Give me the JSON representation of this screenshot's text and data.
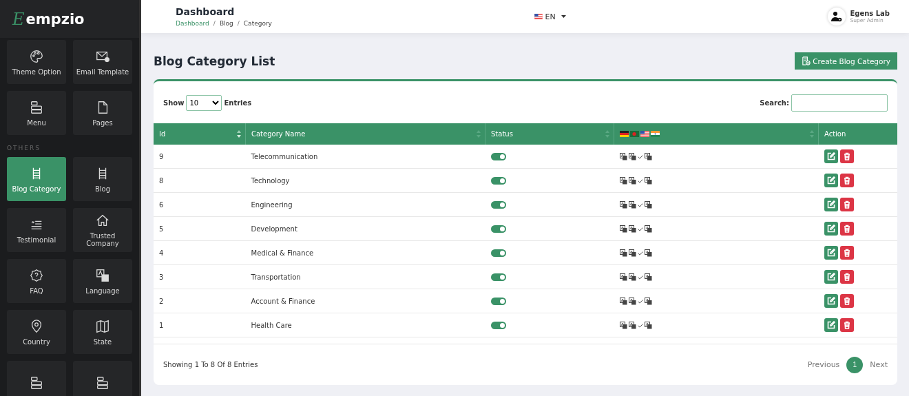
{
  "sidebar": {
    "brand": {
      "mark": "E",
      "name": "empzio"
    },
    "groups": [
      {
        "items": [
          {
            "label": "Theme Option",
            "selected": false
          },
          {
            "label": "Email Template",
            "selected": false
          },
          {
            "label": "Menu",
            "selected": false
          },
          {
            "label": "Pages",
            "selected": false
          }
        ]
      },
      {
        "heading": "OTHERS",
        "items": [
          {
            "label": "Blog Category",
            "selected": true
          },
          {
            "label": "Blog",
            "selected": false
          },
          {
            "label": "Testimonial",
            "selected": false
          },
          {
            "label": "Trusted Company",
            "selected": false
          },
          {
            "label": "FAQ",
            "selected": false
          },
          {
            "label": "Language",
            "selected": false
          },
          {
            "label": "Country",
            "selected": false
          },
          {
            "label": "State",
            "selected": false
          },
          {
            "selected": false
          },
          {
            "selected": false
          }
        ]
      }
    ]
  },
  "topbar": {
    "title": "Dashboard",
    "breadcrumbs": [
      "Dashboard",
      "Blog",
      "Category"
    ],
    "breadcrumb_separator": "/",
    "language": "EN",
    "user": {
      "name": "Egens Lab",
      "role": "Super Admin"
    }
  },
  "page": {
    "title": "Blog Category List",
    "create_button": "Create Blog Category"
  },
  "table": {
    "show_label": "Show",
    "page_size": "10",
    "entries_label": "Entries",
    "search_label": "Search:",
    "columns": [
      {
        "kind": "text",
        "label": "Id",
        "sortable": true
      },
      {
        "kind": "text",
        "label": "Category Name",
        "sortable": true
      },
      {
        "kind": "text",
        "label": "Status",
        "sortable": true
      },
      {
        "kind": "flags",
        "sortable": true
      },
      {
        "kind": "text",
        "label": "Action",
        "sortable": false
      }
    ],
    "rows": [
      {
        "id": "9",
        "name": "Telecommunication",
        "on": true,
        "languages": [
          {
            "kind": "translate"
          },
          {
            "kind": "translate"
          },
          {
            "kind": "current"
          },
          {
            "kind": "translate"
          }
        ]
      },
      {
        "id": "8",
        "name": "Technology",
        "on": true,
        "languages": [
          {
            "kind": "translate"
          },
          {
            "kind": "translate"
          },
          {
            "kind": "current"
          },
          {
            "kind": "translate"
          }
        ]
      },
      {
        "id": "6",
        "name": "Engineering",
        "on": true,
        "languages": [
          {
            "kind": "translate"
          },
          {
            "kind": "translate"
          },
          {
            "kind": "current"
          },
          {
            "kind": "translate"
          }
        ]
      },
      {
        "id": "5",
        "name": "Development",
        "on": true,
        "languages": [
          {
            "kind": "translate"
          },
          {
            "kind": "translate"
          },
          {
            "kind": "current"
          },
          {
            "kind": "translate"
          }
        ]
      },
      {
        "id": "4",
        "name": "Medical & Finance",
        "on": true,
        "languages": [
          {
            "kind": "translate"
          },
          {
            "kind": "translate"
          },
          {
            "kind": "current"
          },
          {
            "kind": "translate"
          }
        ]
      },
      {
        "id": "3",
        "name": "Transportation",
        "on": true,
        "languages": [
          {
            "kind": "translate"
          },
          {
            "kind": "translate"
          },
          {
            "kind": "current"
          },
          {
            "kind": "translate"
          }
        ]
      },
      {
        "id": "2",
        "name": "Account & Finance",
        "on": true,
        "languages": [
          {
            "kind": "translate"
          },
          {
            "kind": "translate"
          },
          {
            "kind": "current"
          },
          {
            "kind": "translate"
          }
        ]
      },
      {
        "id": "1",
        "name": "Health Care",
        "on": true,
        "languages": [
          {
            "kind": "translate"
          },
          {
            "kind": "translate"
          },
          {
            "kind": "current"
          },
          {
            "kind": "translate"
          }
        ]
      }
    ],
    "summary": "Showing 1 To 8 Of 8 Entries",
    "pagination": {
      "previous": "Previous",
      "pages": [
        {
          "label": "1",
          "selected": true
        }
      ],
      "next": "Next"
    }
  }
}
